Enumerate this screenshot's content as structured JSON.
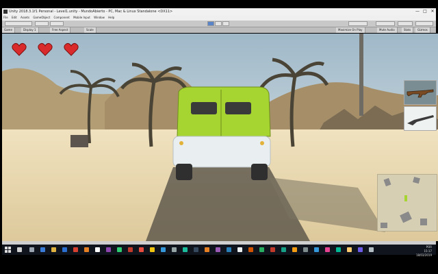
{
  "window": {
    "title": "Unity 2018.3.1f1 Personal - Level1.unity - MundoAbierto - PC, Mac & Linux Standalone <DX11>",
    "minimize": "—",
    "maximize": "□",
    "close": "✕"
  },
  "menu": [
    "File",
    "Edit",
    "Assets",
    "GameObject",
    "Component",
    "Mobile Input",
    "Window",
    "Help"
  ],
  "editor_tabs": {
    "game": "Game",
    "display": "Display 1",
    "aspect": "Free Aspect",
    "scale": "Scale",
    "maximize_on_play": "Maximize On Play",
    "mute_audio": "Mute Audio",
    "stats": "Stats",
    "gizmos": "Gizmos"
  },
  "hud": {
    "hearts": 3,
    "heart_color": "#d92b2b",
    "weapons": [
      {
        "name": "rifle",
        "icon": "rifle-icon",
        "selected": true
      },
      {
        "name": "shotgun",
        "icon": "shotgun-icon",
        "selected": false
      }
    ]
  },
  "vehicle": {
    "color": "#a6d430",
    "type": "van"
  },
  "taskbar": {
    "time": "15:17",
    "date": "18/03/2019",
    "lang": "POR"
  }
}
